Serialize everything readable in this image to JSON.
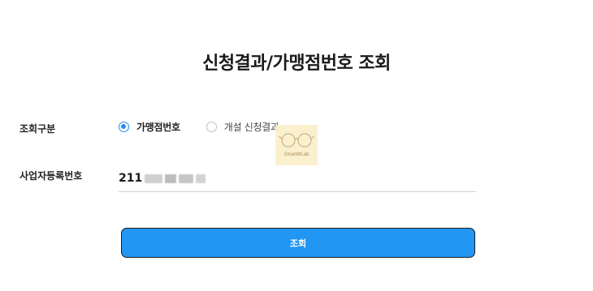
{
  "page": {
    "title": "신청결과/가맹점번호 조회"
  },
  "form": {
    "type_label": "조회구분",
    "type_options": [
      {
        "label": "가맹점번호",
        "selected": true
      },
      {
        "label": "개설 신청결과",
        "selected": false
      }
    ],
    "bizno_label": "사업자등록번호",
    "bizno_value": "211"
  },
  "watermark": {
    "text": "SmartMLab"
  },
  "submit": {
    "label": "조회"
  },
  "colors": {
    "accent": "#2196f3",
    "radio_checked": "#2b8ef0"
  }
}
